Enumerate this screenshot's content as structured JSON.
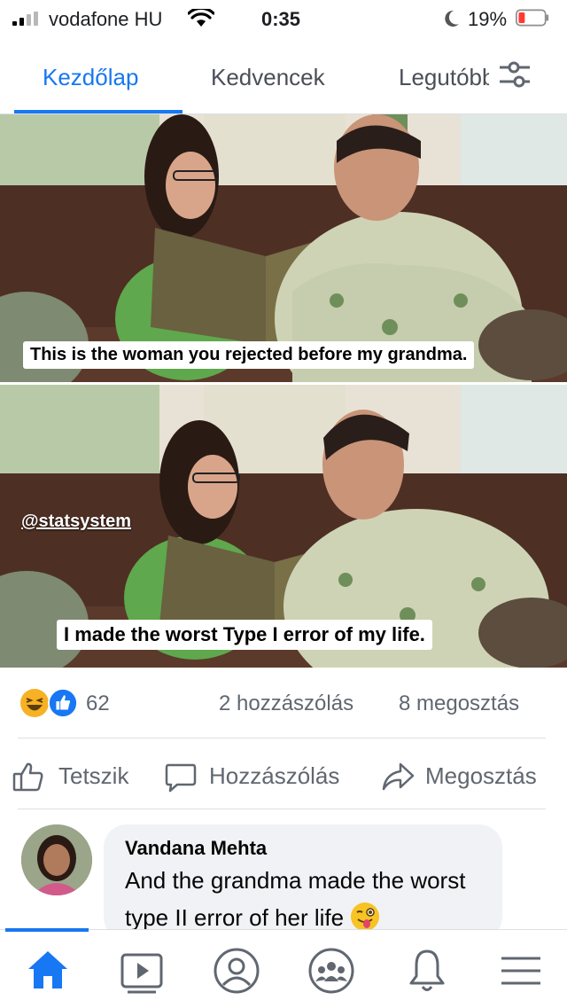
{
  "status_bar": {
    "carrier": "vodafone HU",
    "time": "0:35",
    "battery": "19%"
  },
  "tabs": [
    {
      "label": "Kezdőlap",
      "active": true
    },
    {
      "label": "Kedvencek",
      "active": false
    },
    {
      "label": "Legutóbbiak",
      "active": false
    }
  ],
  "post": {
    "caption_top": "This is the woman you rejected before my grandma.",
    "watermark": "@statsystem",
    "caption_bottom": "I made the worst Type I error of my life.",
    "reaction_count": "62",
    "comments": "2 hozzászólás",
    "shares": "8 megosztás"
  },
  "actions": {
    "like": "Tetszik",
    "comment": "Hozzászólás",
    "share": "Megosztás"
  },
  "comment": {
    "author": "Vandana Mehta",
    "text": "And the grandma made the worst type II error of her life"
  },
  "colors": {
    "accent": "#1877f2",
    "haha": "#f7b125",
    "like": "#1877f2"
  }
}
